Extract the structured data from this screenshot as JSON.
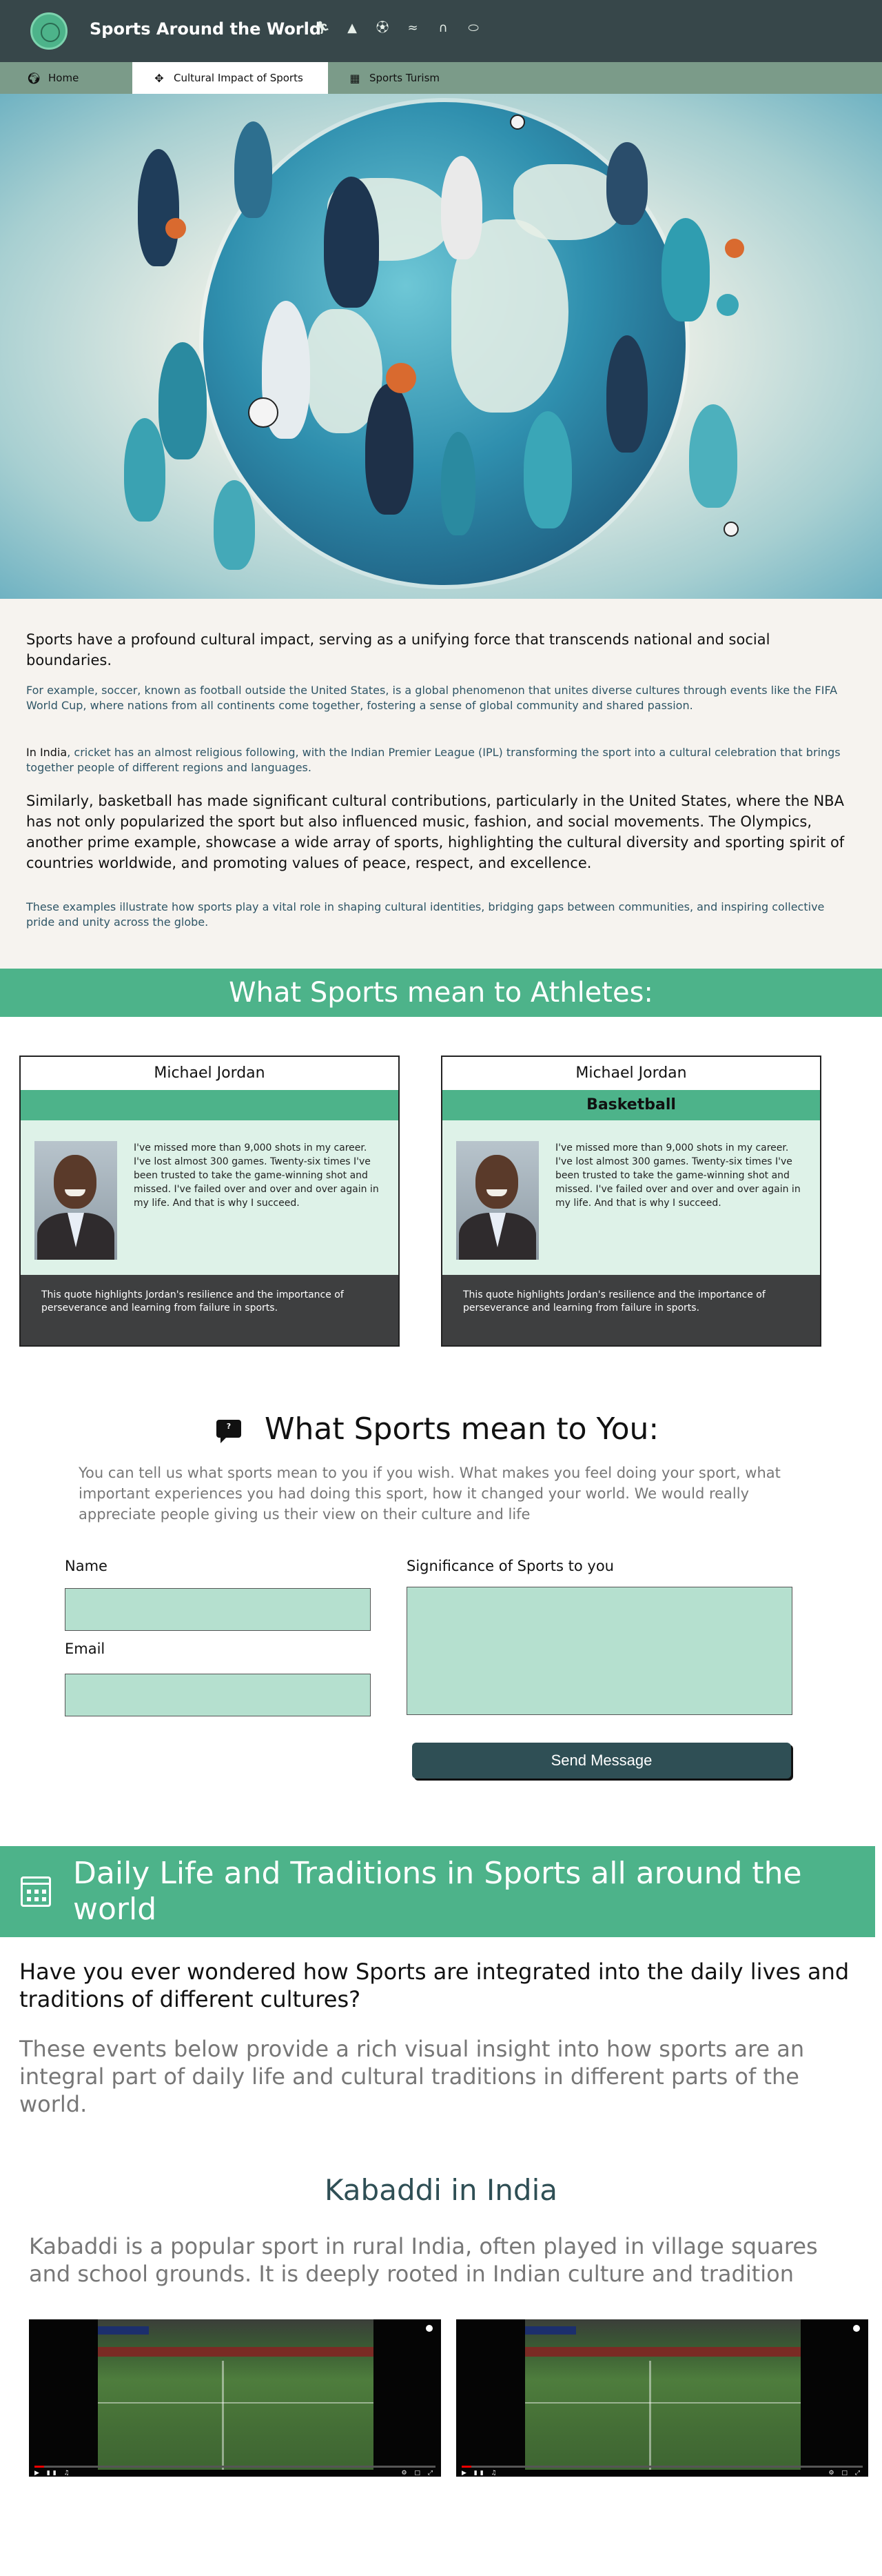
{
  "header": {
    "title": "Sports Around the World",
    "icons": [
      "runner-icon",
      "mountain-icon",
      "soccer-ball-icon",
      "waves-icon",
      "camel-icon",
      "rugby-ball-icon"
    ]
  },
  "tabs": [
    {
      "label": "Home",
      "icon": "globe-icon"
    },
    {
      "label": "Cultural Impact of Sports",
      "icon": "move-arrows-icon"
    },
    {
      "label": "Sports Turism",
      "icon": "building-icon"
    }
  ],
  "intro": {
    "lead": "Sports have a profound cultural impact, serving as a unifying force that transcends national and social boundaries.",
    "p1": "For example, soccer, known as football outside the United States, is a global phenomenon that unites diverse cultures through events like the FIFA World Cup, where nations from all continents come together, fostering a sense of global community and shared passion.",
    "p2_strong": "In India",
    "p2_rest": ", cricket has an almost religious following, with the Indian Premier League (IPL) transforming the sport into a cultural celebration that brings together people of different regions and languages.",
    "p3": "Similarly, basketball has made significant cultural contributions, particularly in the United States, where the NBA has not only popularized the sport but also influenced music, fashion, and social movements. The Olympics, another prime example, showcase a wide array of sports, highlighting the cultural diversity and sporting spirit of countries worldwide, and promoting values of peace, respect, and excellence.",
    "p4": "These examples illustrate how sports play a vital role in shaping cultural identities, bridging gaps between communities, and inspiring collective pride and unity across the globe."
  },
  "athletes": {
    "heading": "What Sports mean to Athletes:",
    "cards": [
      {
        "name": "Michael Jordan",
        "sport": "",
        "quote": "I've missed more than 9,000 shots in my career. I've lost almost 300 games. Twenty-six times I've been trusted to take the game-winning shot and missed. I've failed over and over and over again in my life. And that is why I succeed.",
        "note": "This quote highlights Jordan's resilience and the importance of perseverance and learning from failure in sports."
      },
      {
        "name": "Michael Jordan",
        "sport": "Basketball",
        "quote": "I've missed more than 9,000 shots in my career. I've lost almost 300 games. Twenty-six times I've been trusted to take the game-winning shot and missed. I've failed over and over and over again in my life. And that is why I succeed.",
        "note": "This quote highlights Jordan's resilience and the importance of perseverance and learning from failure in sports."
      }
    ]
  },
  "you": {
    "icon_text": "?",
    "heading": "What Sports mean to You:",
    "description": "You can tell us what sports mean to you if you wish. What makes you feel doing your sport, what important experiences you had doing this sport, how it changed your world. We would really appreciate people giving us their view on their culture and life",
    "name_label": "Name",
    "email_label": "Email",
    "significance_label": "Significance of Sports to you",
    "name_value": "",
    "email_value": "",
    "significance_value": "",
    "send_label": "Send Message"
  },
  "daily": {
    "heading": "Daily Life and Traditions in Sports all around the world",
    "question": "Have you ever wondered how Sports are integrated into the daily lives and traditions of different cultures?",
    "sub": "These events below provide a rich visual insight into how sports are an integral part of daily life and cultural traditions in different parts of the world."
  },
  "kabaddi": {
    "title": "Kabaddi in India",
    "description": "Kabaddi is a popular sport in rural India, often played in village squares and school grounds. It is deeply rooted in Indian culture and tradition"
  },
  "colors": {
    "header_bg": "#37474a",
    "tab_bar": "#7b9b89",
    "accent_green": "#4db38a",
    "field_mint": "#b5e0cf",
    "card_body": "#def2e8",
    "button_dark": "#2f4f55",
    "link_text": "#2e5566"
  }
}
